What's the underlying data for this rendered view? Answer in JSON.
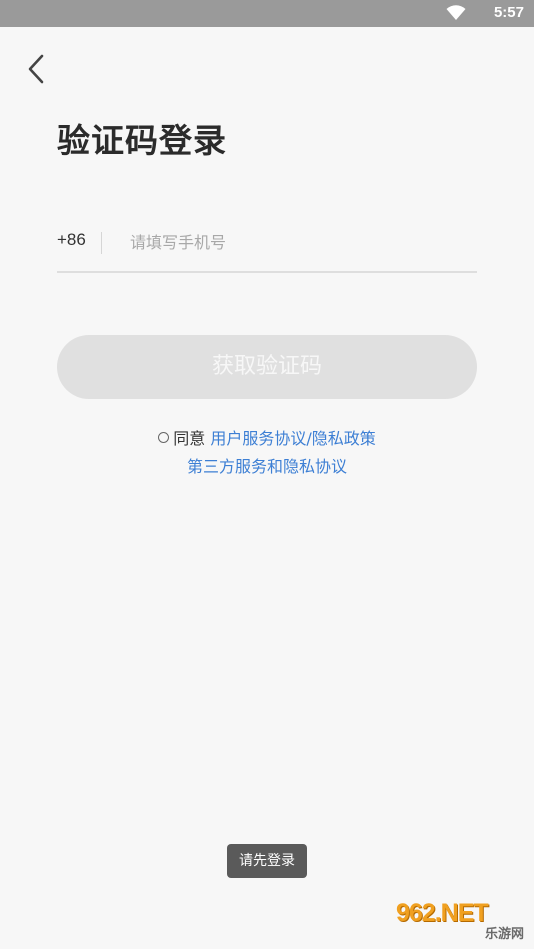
{
  "status_bar": {
    "time": "5:57"
  },
  "title": "验证码登录",
  "phone": {
    "country_code": "+86",
    "placeholder": "请填写手机号",
    "value": ""
  },
  "get_code_button": "获取验证码",
  "agreement": {
    "prefix": "同意",
    "user_agreement": "用户服务协议",
    "separator": "/",
    "privacy_policy": "隐私政策",
    "third_party": "第三方服务和隐私协议"
  },
  "toast": "请先登录",
  "watermark": {
    "top": "962.NET",
    "bottom": "乐游网"
  },
  "colors": {
    "link": "#3d7fd4",
    "button_bg": "#e0e0e0",
    "status_bar": "#9a9a9a"
  }
}
